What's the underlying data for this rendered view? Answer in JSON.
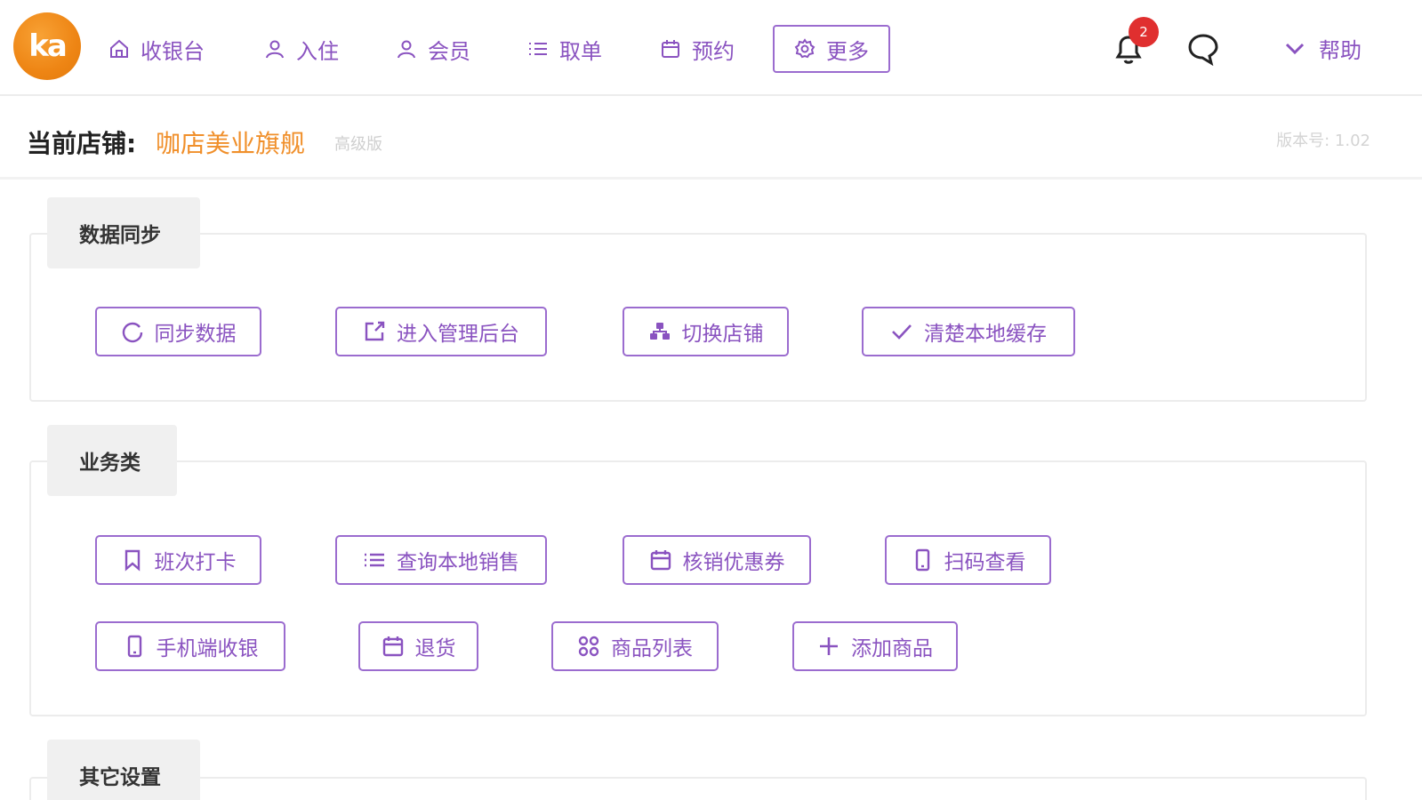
{
  "brand": {
    "logo_text": "ka",
    "accent": "#8a53c0",
    "logo_color": "#ee8514"
  },
  "nav": {
    "items": [
      {
        "label": "收银台",
        "icon": "home-icon"
      },
      {
        "label": "入住",
        "icon": "user-icon"
      },
      {
        "label": "会员",
        "icon": "user-icon"
      },
      {
        "label": "取单",
        "icon": "list-icon"
      },
      {
        "label": "预约",
        "icon": "calendar-icon"
      },
      {
        "label": "更多",
        "icon": "gear-icon",
        "active": true
      }
    ],
    "notification_count": "2",
    "help_label": "帮助"
  },
  "store": {
    "label": "当前店铺:",
    "name": "咖店美业旗舰",
    "tier": "高级版",
    "version": "版本号: 1.02"
  },
  "sections": [
    {
      "title": "数据同步",
      "buttons": [
        {
          "label": "同步数据",
          "icon": "refresh-icon"
        },
        {
          "label": "进入管理后台",
          "icon": "external-link-icon"
        },
        {
          "label": "切换店铺",
          "icon": "switch-store-icon"
        },
        {
          "label": "清楚本地缓存",
          "icon": "check-icon"
        }
      ]
    },
    {
      "title": "业务类",
      "buttons": [
        {
          "label": "班次打卡",
          "icon": "bookmark-icon"
        },
        {
          "label": "查询本地销售",
          "icon": "list-icon"
        },
        {
          "label": "核销优惠券",
          "icon": "calendar-icon"
        },
        {
          "label": "扫码查看",
          "icon": "mobile-icon"
        },
        {
          "label": "手机端收银",
          "icon": "mobile-icon"
        },
        {
          "label": "退货",
          "icon": "calendar-icon"
        },
        {
          "label": "商品列表",
          "icon": "grid-icon"
        },
        {
          "label": "添加商品",
          "icon": "plus-icon"
        }
      ]
    },
    {
      "title": "其它设置",
      "buttons": []
    }
  ]
}
